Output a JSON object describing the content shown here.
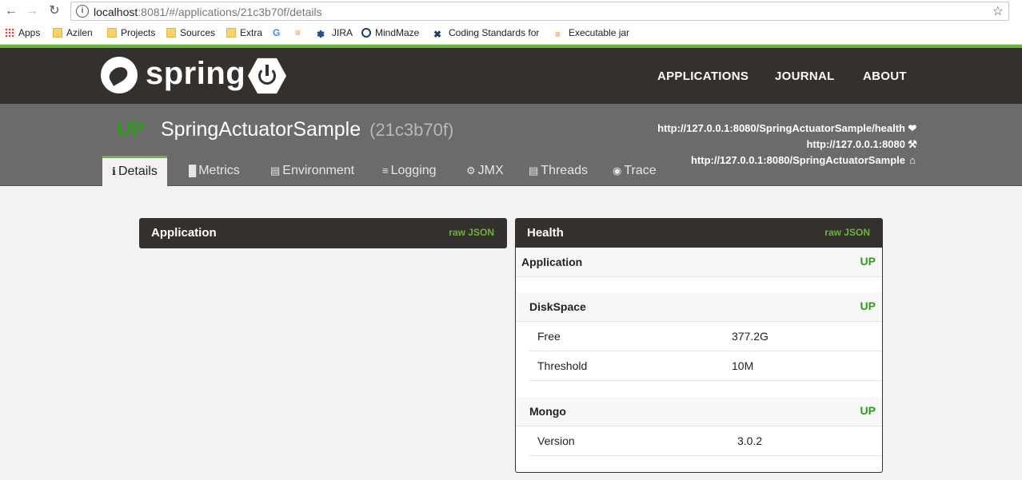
{
  "browser": {
    "url_host": "localhost",
    "url_rest": ":8081/#/applications/21c3b70f/details",
    "bookmarks": [
      "Apps",
      "Azilen",
      "Projects",
      "Sources",
      "Extra",
      "JIRA",
      "MindMaze",
      "Coding Standards for",
      "Executable jar"
    ]
  },
  "header": {
    "logo_text": "spring",
    "nav": [
      "APPLICATIONS",
      "JOURNAL",
      "ABOUT"
    ]
  },
  "app": {
    "status": "UP",
    "name": "SpringActuatorSample",
    "id": "(21c3b70f)",
    "urls": [
      {
        "text": "http://127.0.0.1:8080/SpringActuatorSample/health",
        "icon": "heart-icon"
      },
      {
        "text": "http://127.0.0.1:8080",
        "icon": "wrench-icon"
      },
      {
        "text": "http://127.0.0.1:8080/SpringActuatorSample",
        "icon": "home-icon"
      }
    ]
  },
  "tabs": [
    {
      "label": "Details",
      "icon": "info-icon"
    },
    {
      "label": "Metrics",
      "icon": "bar-chart-icon"
    },
    {
      "label": "Environment",
      "icon": "list-icon"
    },
    {
      "label": "Logging",
      "icon": "sliders-icon"
    },
    {
      "label": "JMX",
      "icon": "cogs-icon"
    },
    {
      "label": "Threads",
      "icon": "list-icon"
    },
    {
      "label": "Trace",
      "icon": "eye-icon"
    }
  ],
  "application_panel": {
    "title": "Application",
    "raw": "raw JSON"
  },
  "health_panel": {
    "title": "Health",
    "raw": "raw JSON",
    "application": {
      "label": "Application",
      "status": "UP"
    },
    "diskspace": {
      "label": "DiskSpace",
      "status": "UP",
      "free_label": "Free",
      "free_value": "377.2G",
      "threshold_label": "Threshold",
      "threshold_value": "10M"
    },
    "mongo": {
      "label": "Mongo",
      "status": "UP",
      "version_label": "Version",
      "version_value": "3.0.2"
    }
  },
  "colors": {
    "brand_green": "#6db33f",
    "status_up": "#2b9b19",
    "header_bg": "#34302d"
  }
}
